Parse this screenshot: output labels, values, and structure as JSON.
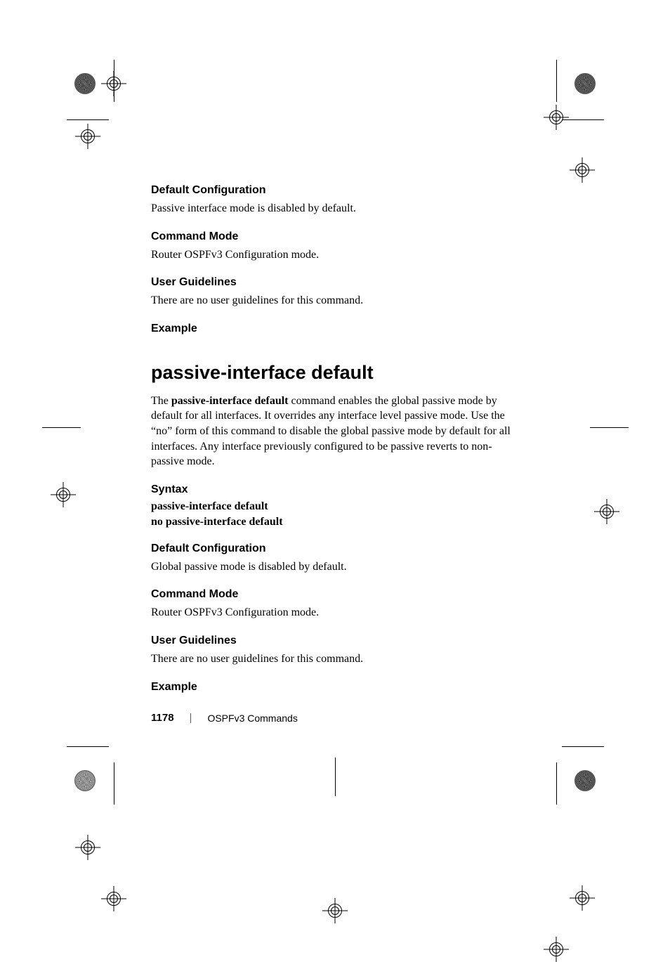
{
  "sections": {
    "s1": {
      "head": "Default Configuration",
      "body": "Passive interface mode is disabled by default."
    },
    "s2": {
      "head": "Command Mode",
      "body": "Router OSPFv3 Configuration mode."
    },
    "s3": {
      "head": "User Guidelines",
      "body": "There are no user guidelines for this command."
    },
    "s4": {
      "head": "Example"
    }
  },
  "command": {
    "title": "passive-interface default",
    "desc_pre": "The ",
    "desc_bold": "passive-interface default",
    "desc_post": " command enables the global passive mode by default for all interfaces. It overrides any interface level passive mode. Use the “no” form of this command to disable the global passive mode by default for all interfaces. Any interface previously configured to be passive reverts to non-passive mode."
  },
  "syntax": {
    "head": "Syntax",
    "line1": "passive-interface default",
    "line2": "no passive-interface default"
  },
  "sections2": {
    "d1": {
      "head": "Default Configuration",
      "body": "Global passive mode is disabled by default."
    },
    "d2": {
      "head": "Command Mode",
      "body": "Router OSPFv3 Configuration mode."
    },
    "d3": {
      "head": "User Guidelines",
      "body": "There are no user guidelines for this command."
    },
    "d4": {
      "head": "Example"
    }
  },
  "footer": {
    "page": "1178",
    "sep": "|",
    "chapter": "OSPFv3 Commands"
  }
}
